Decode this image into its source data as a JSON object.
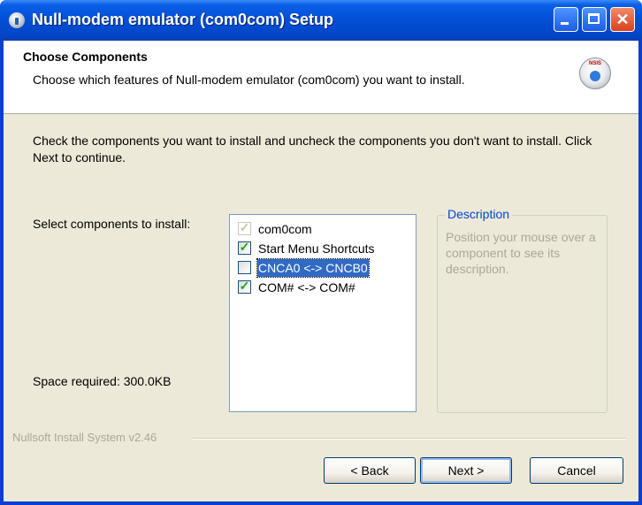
{
  "window": {
    "title": "Null-modem emulator (com0com) Setup"
  },
  "header": {
    "title": "Choose Components",
    "subtitle": "Choose which features of Null-modem emulator (com0com) you want to install.",
    "icon": "nsis-installer-icon"
  },
  "body": {
    "intro": "Check the components you want to install and uncheck the components you don't want to install. Click Next to continue.",
    "select_label": "Select components to install:",
    "space_label": "Space required: 300.0KB"
  },
  "components": [
    {
      "label": "com0com",
      "checked": true,
      "disabled": true,
      "selected": false
    },
    {
      "label": "Start Menu Shortcuts",
      "checked": true,
      "disabled": false,
      "selected": false
    },
    {
      "label": "CNCA0 <-> CNCB0",
      "checked": false,
      "disabled": false,
      "selected": true
    },
    {
      "label": "COM# <-> COM#",
      "checked": true,
      "disabled": false,
      "selected": false
    }
  ],
  "description": {
    "title": "Description",
    "text": "Position your mouse over a component to see its description."
  },
  "footer": {
    "branding": "Nullsoft Install System v2.46"
  },
  "buttons": {
    "back": "< Back",
    "next": "Next >",
    "cancel": "Cancel"
  },
  "colors": {
    "titlebar": "#0350d8",
    "dialog_bg": "#ece9d8",
    "selection": "#316ac5",
    "description_title": "#0046d5",
    "check": "#21a121"
  }
}
